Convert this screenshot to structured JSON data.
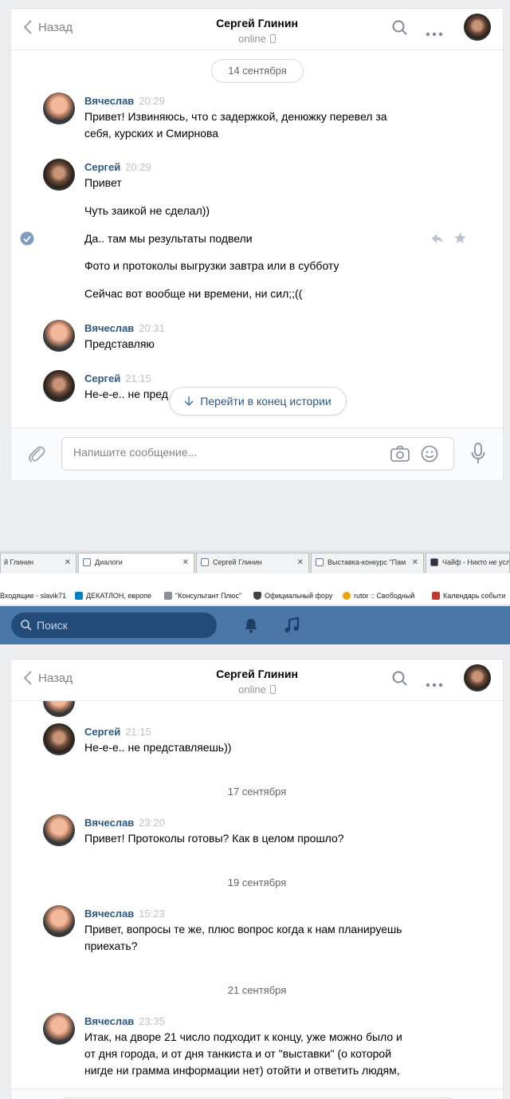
{
  "top": {
    "header": {
      "back_label": "Назад",
      "title": "Сергей Глинин",
      "status": "online"
    },
    "date_pill": "14 сентября",
    "messages": [
      {
        "author": "Вячеслав",
        "time": "20:29",
        "lines": [
          "Привет! Извиняюсь, что с задержкой, денюжку перевел за",
          "себя, курских и Смирнова"
        ]
      },
      {
        "author": "Сергей",
        "time": "20:29",
        "lines": [
          "Привет"
        ]
      },
      {
        "text": "Чуть заикой не сделал))"
      },
      {
        "text": "Да.. там мы результаты подвели"
      },
      {
        "text": "Фото и протоколы выгрузки завтра или в субботу"
      },
      {
        "text": "Сейчас вот вообще ни времени, ни сил;;(("
      },
      {
        "author": "Вячеслав",
        "time": "20:31",
        "lines": [
          "Представляю"
        ]
      },
      {
        "author": "Сергей",
        "time": "21:15",
        "lines": [
          "Не-е-е.. не пред"
        ]
      }
    ],
    "goto_label": "Перейти в конец истории",
    "composer_placeholder": "Напишите сообщение..."
  },
  "browser": {
    "tabs": [
      "й Глинин",
      "Диалоги",
      "Сергей Глинин",
      "Выставка-конкурс \"Пам",
      "Чайф - Никто не услы"
    ],
    "bookmarks": [
      "Входящие - slavik71",
      "ДЕКАТЛОН, европе",
      "\"Консультант Плюс\"",
      "Официальный фору",
      "rutor :: Свободный",
      "Календарь событи"
    ],
    "search_label": "Поиск"
  },
  "bottom": {
    "header": {
      "back_label": "Назад",
      "title": "Сергей Глинин",
      "status": "online"
    },
    "messages": [
      {
        "author": "Сергей",
        "time": "21:15",
        "lines": [
          "Не-е-е.. не представляешь))"
        ]
      },
      {
        "date": "17 сентября"
      },
      {
        "author": "Вячеслав",
        "time": "23:20",
        "lines": [
          "Привет! Протоколы готовы? Как в целом прошло?"
        ]
      },
      {
        "date": "19 сентября"
      },
      {
        "author": "Вячеслав",
        "time": "15:23",
        "lines": [
          "Привет, вопросы те же, плюс вопрос когда к нам планируешь",
          "приехать?"
        ]
      },
      {
        "date": "21 сентября"
      },
      {
        "author": "Вячеслав",
        "time": "23:35",
        "lines": [
          "Итак, на дворе 21 число подходит к концу, уже можно было и",
          "от дня города, и от дня танкиста и от \"выставки\" (о которой",
          "нигде ни грамма информации нет) отойти и ответить людям,"
        ]
      }
    ]
  },
  "colors": {
    "link": "#2a5885",
    "vk_bar": "#4a76a8",
    "check": "#7f9cc0"
  }
}
